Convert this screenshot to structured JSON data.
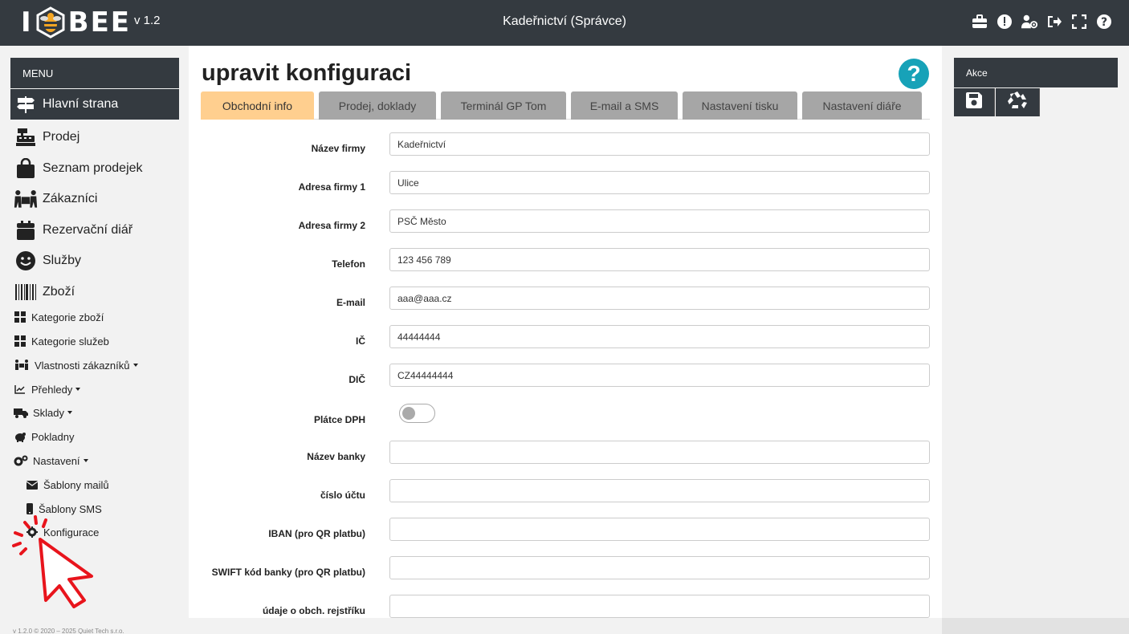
{
  "app": {
    "version": "v 1.2",
    "title": "Kadeřnictví (Správce)"
  },
  "colors": {
    "topbar": "#343a40",
    "accent_tab": "#ffcf8f",
    "help": "#17a2b8",
    "cursor": "#e8141c"
  },
  "top_icons": [
    "briefcase-icon",
    "alert-icon",
    "user-settings-icon",
    "logout-icon",
    "fullscreen-icon",
    "help-icon"
  ],
  "sidebar": {
    "menu_label": "MENU",
    "main_items": [
      {
        "label": "Hlavní strana",
        "icon": "signpost-icon",
        "active": true
      },
      {
        "label": "Prodej",
        "icon": "cash-register-icon"
      },
      {
        "label": "Seznam prodejek",
        "icon": "shopping-bag-icon"
      },
      {
        "label": "Zákazníci",
        "icon": "people-carry-icon"
      },
      {
        "label": "Rezervační diář",
        "icon": "calendar-icon"
      },
      {
        "label": "Služby",
        "icon": "smile-icon"
      },
      {
        "label": "Zboží",
        "icon": "barcode-icon"
      }
    ],
    "sub_items": [
      {
        "label": "Kategorie zboží",
        "icon": "grid-icon"
      },
      {
        "label": "Kategorie služeb",
        "icon": "grid-icon"
      },
      {
        "label": "Vlastnosti zákazníků",
        "icon": "people-icon",
        "dropdown": true
      },
      {
        "label": "Přehledy",
        "icon": "chart-line-icon",
        "dropdown": true
      },
      {
        "label": "Sklady",
        "icon": "truck-icon",
        "dropdown": true
      },
      {
        "label": "Pokladny",
        "icon": "piggy-bank-icon"
      },
      {
        "label": "Nastavení",
        "icon": "cogs-icon",
        "dropdown": true
      }
    ],
    "settings_items": [
      {
        "label": "Šablony mailů",
        "icon": "envelope-icon"
      },
      {
        "label": "Šablony SMS",
        "icon": "mobile-icon"
      },
      {
        "label": "Konfigurace",
        "icon": "cog-icon"
      }
    ],
    "footer": "v 1.2.0 © 2020 – 2025 Quiet Tech s.r.o."
  },
  "main": {
    "title": "upravit konfiguraci",
    "help_symbol": "?",
    "tabs": [
      {
        "label": "Obchodní info",
        "active": true
      },
      {
        "label": "Prodej, doklady"
      },
      {
        "label": "Terminál GP Tom"
      },
      {
        "label": "E-mail a SMS"
      },
      {
        "label": "Nastavení tisku"
      },
      {
        "label": "Nastavení diáře"
      }
    ],
    "fields": [
      {
        "label": "Název firmy",
        "value": "Kadeřnictví"
      },
      {
        "label": "Adresa firmy 1",
        "value": "Ulice"
      },
      {
        "label": "Adresa firmy 2",
        "value": "PSČ Město"
      },
      {
        "label": "Telefon",
        "value": "123 456 789"
      },
      {
        "label": "E-mail",
        "value": "aaa@aaa.cz"
      },
      {
        "label": "IČ",
        "value": "44444444"
      },
      {
        "label": "DIČ",
        "value": "CZ44444444"
      },
      {
        "label": "Plátce DPH",
        "toggle": true,
        "checked": false
      },
      {
        "label": "Název banky",
        "value": ""
      },
      {
        "label": "číslo účtu",
        "value": ""
      },
      {
        "label": "IBAN (pro QR platbu)",
        "value": ""
      },
      {
        "label": "SWIFT kód banky (pro QR platbu)",
        "value": ""
      },
      {
        "label": "údaje o obch. rejstříku",
        "value": ""
      }
    ]
  },
  "actions": {
    "header": "Akce",
    "buttons": [
      {
        "icon": "save-icon"
      },
      {
        "icon": "recycle-icon"
      }
    ]
  }
}
